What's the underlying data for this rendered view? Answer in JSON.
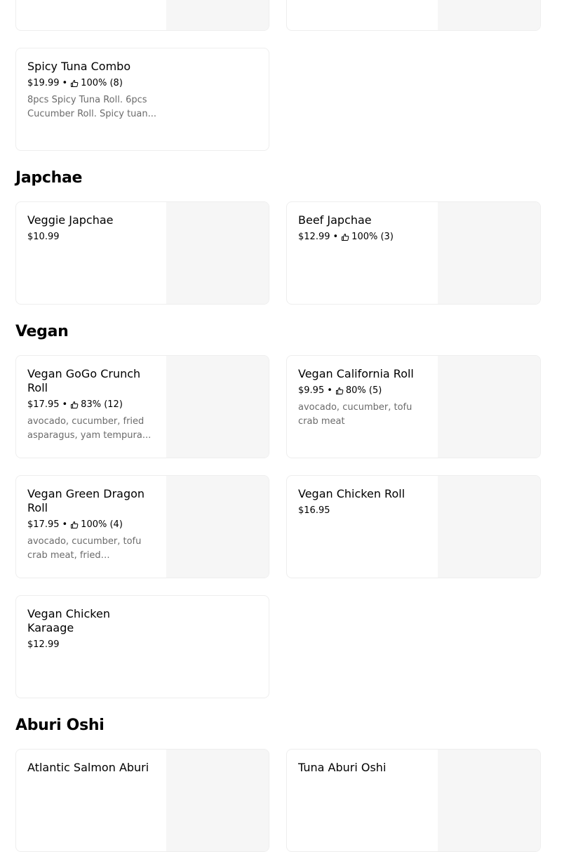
{
  "sections": [
    {
      "title": "Japchae",
      "items": [
        {
          "name": "Veggie Japchae",
          "price": "$10.99"
        },
        {
          "name": "Beef Japchae",
          "price": "$12.99",
          "rating": "100% (3)"
        }
      ]
    },
    {
      "title": "Vegan",
      "items": [
        {
          "name": "Vegan GoGo Crunch Roll",
          "price": "$17.95",
          "rating": "83% (12)",
          "description": "avocado, cucumber, fried asparagus, yam tempura..."
        },
        {
          "name": "Vegan California Roll",
          "price": "$9.95",
          "rating": "80% (5)",
          "description": "avocado, cucumber, tofu crab meat"
        },
        {
          "name": "Vegan Green Dragon Roll",
          "price": "$17.95",
          "rating": "100% (4)",
          "description": "avocado, cucumber, tofu crab meat, fried asparagus..."
        },
        {
          "name": "Vegan Chicken Roll",
          "price": "$16.95"
        },
        {
          "name": "Vegan Chicken Karaage",
          "price": "$12.99"
        }
      ]
    },
    {
      "title": "Aburi Oshi",
      "items": [
        {
          "name": "Atlantic Salmon Aburi"
        },
        {
          "name": "Tuna Aburi Oshi"
        }
      ]
    }
  ],
  "top_items": [
    {
      "name": "Spicy Tuna Combo",
      "price": "$19.99",
      "rating": "100% (8)",
      "description": "8pcs Spicy Tuna Roll. 6pcs Cucumber Roll. Spicy tuan..."
    }
  ],
  "separator": "•",
  "icons": {
    "rating": "thumbs-up-icon"
  }
}
